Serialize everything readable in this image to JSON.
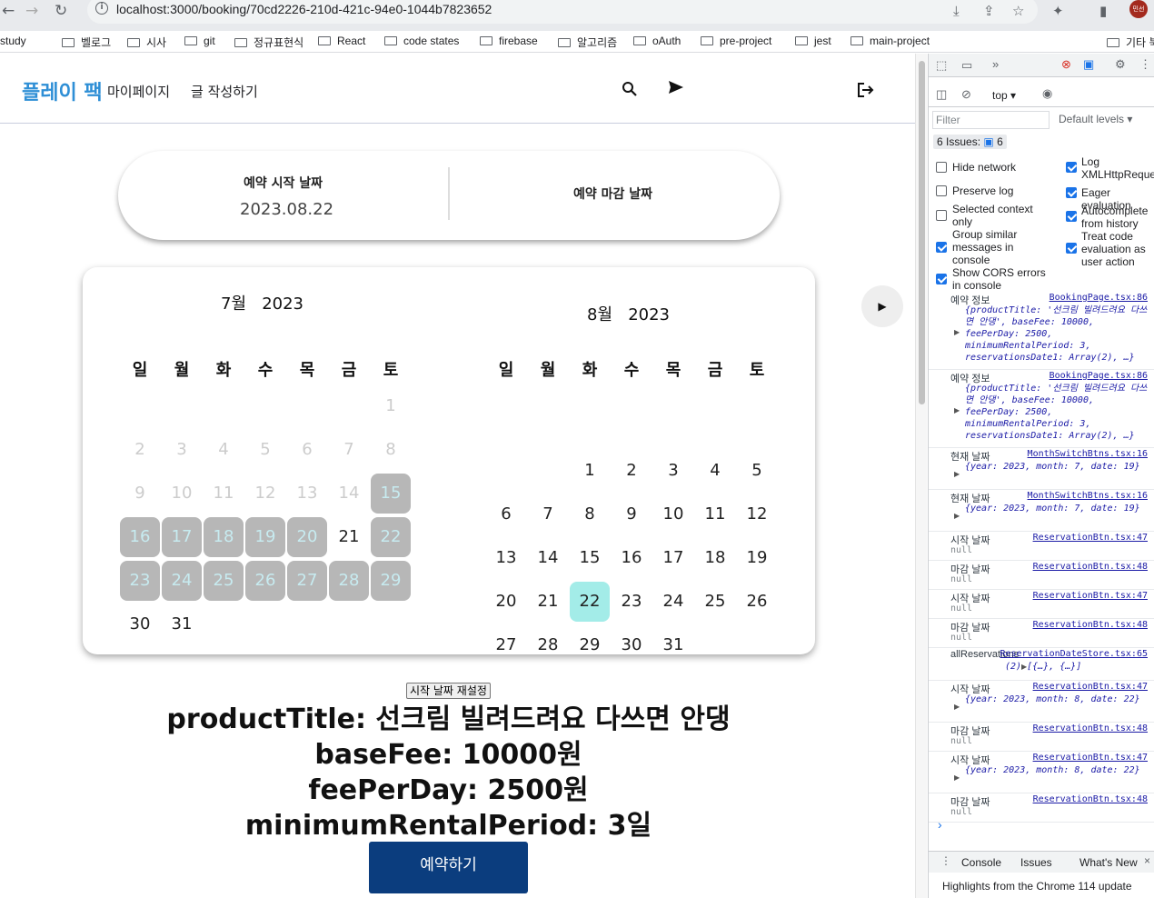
{
  "browser": {
    "url": "localhost:3000/booking/70cd2226-210d-421c-94e0-1044b7823652",
    "back_icon": "arrow-left-icon",
    "forward_icon": "arrow-right-icon",
    "reload_icon": "reload-icon",
    "avatar_label": "민선",
    "bookmarks": [
      "study",
      "벨로그",
      "시사",
      "git",
      "정규표현식",
      "React",
      "code states",
      "firebase",
      "알고리즘",
      "oAuth",
      "pre-project",
      "jest",
      "main-project",
      "기타 북"
    ]
  },
  "header": {
    "logo": "플레이 팩",
    "nav": [
      "마이페이지",
      "글 작성하기"
    ]
  },
  "booking": {
    "start_label": "예약 시작 날짜",
    "start_value": "2023.08.22",
    "end_label": "예약 마감 날짜",
    "end_value": ""
  },
  "calendar": {
    "weekdays": [
      "일",
      "월",
      "화",
      "수",
      "목",
      "금",
      "토"
    ],
    "left": {
      "month": "7월",
      "year": "2023",
      "rows": [
        [
          null,
          null,
          null,
          null,
          null,
          null,
          {
            "d": "1",
            "s": "past"
          }
        ],
        [
          {
            "d": "2",
            "s": "past"
          },
          {
            "d": "3",
            "s": "past"
          },
          {
            "d": "4",
            "s": "past"
          },
          {
            "d": "5",
            "s": "past"
          },
          {
            "d": "6",
            "s": "past"
          },
          {
            "d": "7",
            "s": "past"
          },
          {
            "d": "8",
            "s": "past"
          }
        ],
        [
          {
            "d": "9",
            "s": "past"
          },
          {
            "d": "10",
            "s": "past"
          },
          {
            "d": "11",
            "s": "past"
          },
          {
            "d": "12",
            "s": "past"
          },
          {
            "d": "13",
            "s": "past"
          },
          {
            "d": "14",
            "s": "past"
          },
          {
            "d": "15",
            "s": "booked"
          }
        ],
        [
          {
            "d": "16",
            "s": "booked"
          },
          {
            "d": "17",
            "s": "booked"
          },
          {
            "d": "18",
            "s": "booked"
          },
          {
            "d": "19",
            "s": "booked"
          },
          {
            "d": "20",
            "s": "booked"
          },
          {
            "d": "21",
            "s": ""
          },
          {
            "d": "22",
            "s": "booked"
          }
        ],
        [
          {
            "d": "23",
            "s": "booked"
          },
          {
            "d": "24",
            "s": "booked"
          },
          {
            "d": "25",
            "s": "booked"
          },
          {
            "d": "26",
            "s": "booked"
          },
          {
            "d": "27",
            "s": "booked"
          },
          {
            "d": "28",
            "s": "booked"
          },
          {
            "d": "29",
            "s": "booked"
          }
        ],
        [
          {
            "d": "30",
            "s": ""
          },
          {
            "d": "31",
            "s": ""
          },
          null,
          null,
          null,
          null,
          null
        ]
      ]
    },
    "right": {
      "month": "8월",
      "year": "2023",
      "rows": [
        [
          null,
          null,
          {
            "d": "1",
            "s": ""
          },
          {
            "d": "2",
            "s": ""
          },
          {
            "d": "3",
            "s": ""
          },
          {
            "d": "4",
            "s": ""
          },
          {
            "d": "5",
            "s": ""
          }
        ],
        [
          {
            "d": "6",
            "s": ""
          },
          {
            "d": "7",
            "s": ""
          },
          {
            "d": "8",
            "s": ""
          },
          {
            "d": "9",
            "s": ""
          },
          {
            "d": "10",
            "s": ""
          },
          {
            "d": "11",
            "s": ""
          },
          {
            "d": "12",
            "s": ""
          }
        ],
        [
          {
            "d": "13",
            "s": ""
          },
          {
            "d": "14",
            "s": ""
          },
          {
            "d": "15",
            "s": ""
          },
          {
            "d": "16",
            "s": ""
          },
          {
            "d": "17",
            "s": ""
          },
          {
            "d": "18",
            "s": ""
          },
          {
            "d": "19",
            "s": ""
          }
        ],
        [
          {
            "d": "20",
            "s": ""
          },
          {
            "d": "21",
            "s": ""
          },
          {
            "d": "22",
            "s": "sel"
          },
          {
            "d": "23",
            "s": ""
          },
          {
            "d": "24",
            "s": ""
          },
          {
            "d": "25",
            "s": ""
          },
          {
            "d": "26",
            "s": ""
          }
        ],
        [
          {
            "d": "27",
            "s": ""
          },
          {
            "d": "28",
            "s": ""
          },
          {
            "d": "29",
            "s": ""
          },
          {
            "d": "30",
            "s": ""
          },
          {
            "d": "31",
            "s": ""
          },
          null,
          null
        ]
      ]
    },
    "next_icon": "play-right-icon"
  },
  "reset_button": "시작 날짜 재설정",
  "product": {
    "title_line": "productTitle: 선크림 빌려드려요 다쓰면 안댕",
    "basefee_line": "baseFee: 10000원",
    "feeperday_line": "feePerDay: 2500원",
    "minrental_line": "minimumRentalPeriod: 3일"
  },
  "book_button": "예약하기",
  "devtools": {
    "context": "top",
    "filter_placeholder": "Filter",
    "default_levels": "Default levels ▾",
    "issues": "6 Issues:",
    "issues_count": "6",
    "options_left": [
      "Hide network",
      "Preserve log",
      "Selected context only",
      "Group similar messages in console",
      "Show CORS errors in console"
    ],
    "options_left_checked": [
      false,
      false,
      false,
      true,
      true
    ],
    "options_right": [
      "Log XMLHttpRequests",
      "Eager evaluation",
      "Autocomplete from history",
      "Treat code evaluation as user action"
    ],
    "options_right_checked": [
      true,
      true,
      true,
      true
    ],
    "logs": [
      {
        "label": "예약 정보",
        "src": "BookingPage.tsx:86",
        "body": "{productTitle: '선크림 빌려드려요 다쓰면 안댕', baseFee: 10000, feePerDay: 2500, minimumRentalPeriod: 3, reservationsDate1: Array(2), …}"
      },
      {
        "label": "예약 정보",
        "src": "BookingPage.tsx:86",
        "body": "{productTitle: '선크림 빌려드려요 다쓰면 안댕', baseFee: 10000, feePerDay: 2500, minimumRentalPeriod: 3, reservationsDate1: Array(2), …}"
      },
      {
        "label": "현재 날짜",
        "src": "MonthSwitchBtns.tsx:16",
        "body": "{year: 2023, month: 7, date: 19}"
      },
      {
        "label": "현재 날짜",
        "src": "MonthSwitchBtns.tsx:16",
        "body": "{year: 2023, month: 7, date: 19}"
      },
      {
        "label": "시작 날짜",
        "src": "ReservationBtn.tsx:47",
        "null": "null"
      },
      {
        "label": "마감 날짜",
        "src": "ReservationBtn.tsx:48",
        "null": "null"
      },
      {
        "label": "시작 날짜",
        "src": "ReservationBtn.tsx:47",
        "null": "null"
      },
      {
        "label": "마감 날짜",
        "src": "ReservationBtn.tsx:48",
        "null": "null"
      },
      {
        "label": "allReservations",
        "src": "ReservationDateStore.tsx:65",
        "body": "(2) [{…}, {…}]"
      },
      {
        "label": "시작 날짜",
        "src": "ReservationBtn.tsx:47",
        "body": "{year: 2023, month: 8, date: 22}"
      },
      {
        "label": "마감 날짜",
        "src": "ReservationBtn.tsx:48",
        "null": "null"
      },
      {
        "label": "시작 날짜",
        "src": "ReservationBtn.tsx:47",
        "body": "{year: 2023, month: 8, date: 22}"
      },
      {
        "label": "마감 날짜",
        "src": "ReservationBtn.tsx:48",
        "null": "null"
      }
    ],
    "prompt": "›",
    "tabs": [
      "Console",
      "Issues",
      "What's New"
    ],
    "highlights": "Highlights from the Chrome 114 update"
  },
  "colors": {
    "brand": "#2f8fd6",
    "booked": "#b7b7b7",
    "selected": "#a3ece8",
    "book_button": "#0b3d7e"
  }
}
